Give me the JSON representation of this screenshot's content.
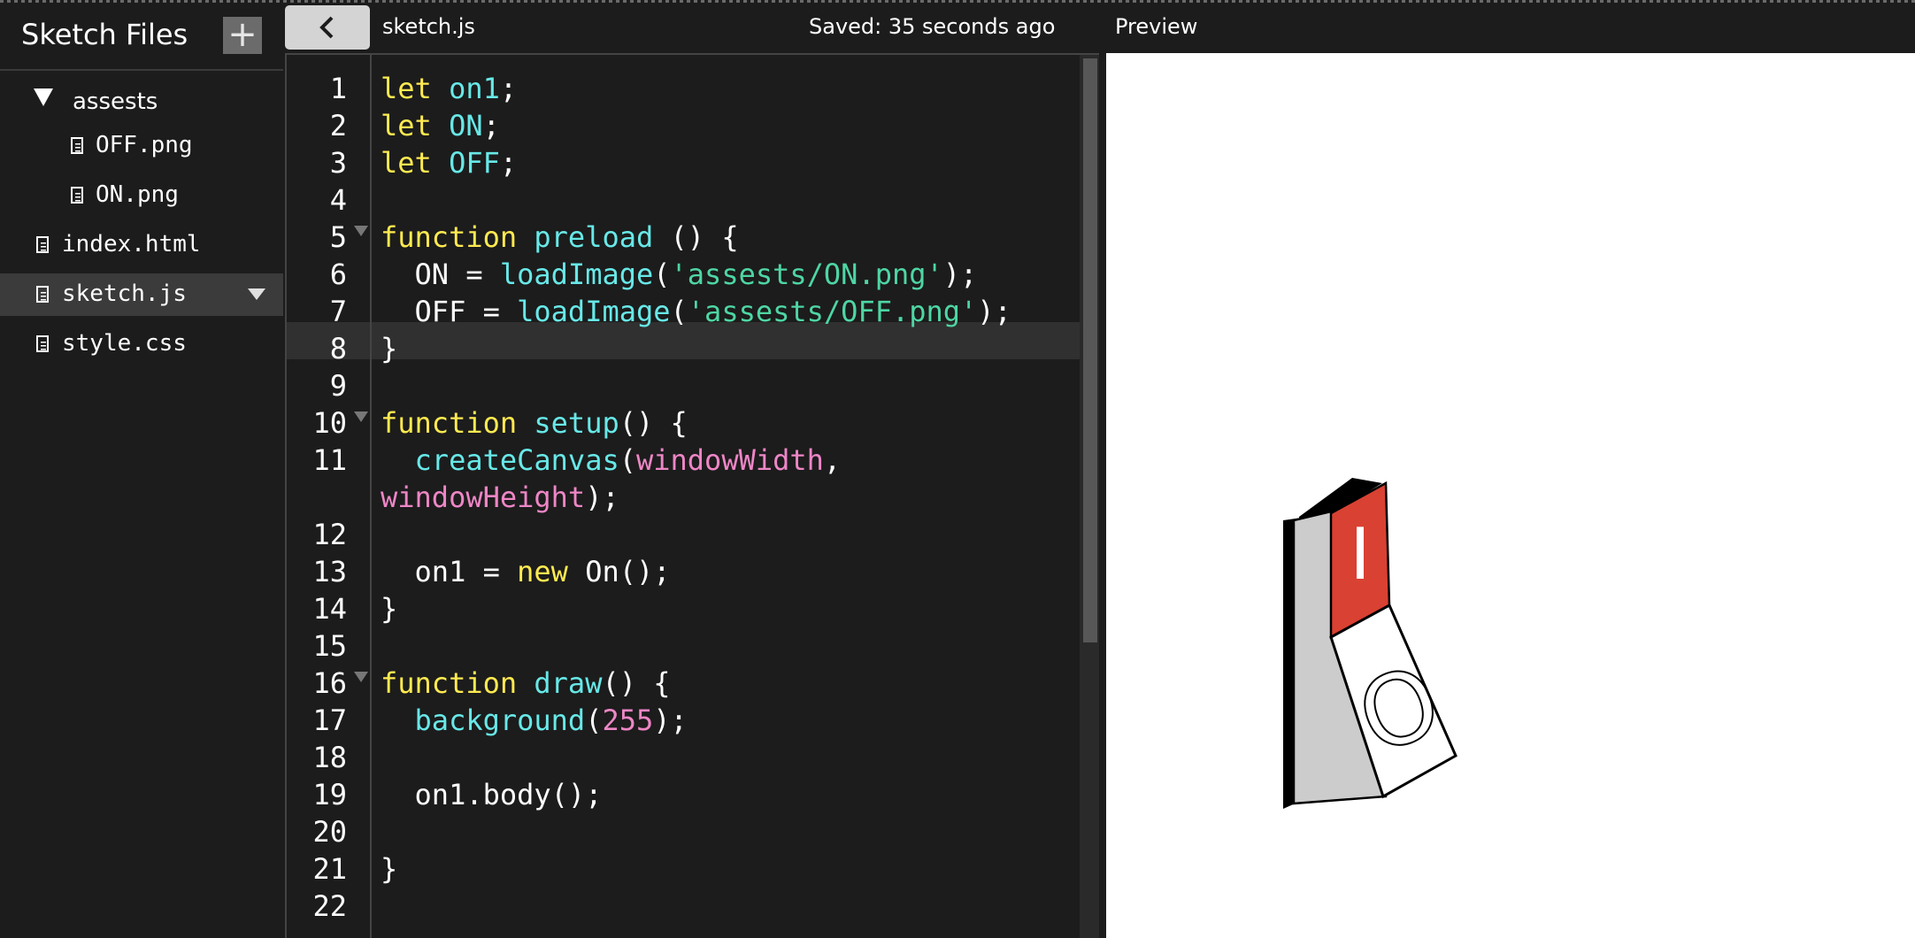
{
  "sidebar": {
    "title": "Sketch Files",
    "add_button": "+",
    "folder": {
      "name": "assests",
      "files": [
        "OFF.png",
        "ON.png"
      ]
    },
    "files": [
      "index.html",
      "sketch.js",
      "style.css"
    ],
    "selected_file": "sketch.js"
  },
  "editor": {
    "filename": "sketch.js",
    "save_status": "Saved: 35 seconds ago",
    "active_line": 7,
    "line_numbers": [
      "1",
      "2",
      "3",
      "4",
      "5",
      "6",
      "7",
      "8",
      "9",
      "10",
      "11",
      "12",
      "13",
      "14",
      "15",
      "16",
      "17",
      "18",
      "19",
      "20",
      "21",
      "22"
    ],
    "fold_lines": [
      5,
      10,
      16
    ],
    "code_lines": [
      [
        [
          "kw",
          "let "
        ],
        [
          "id",
          "on1"
        ],
        [
          "pl",
          ";"
        ]
      ],
      [
        [
          "kw",
          "let "
        ],
        [
          "id",
          "ON"
        ],
        [
          "pl",
          ";"
        ]
      ],
      [
        [
          "kw",
          "let "
        ],
        [
          "id",
          "OFF"
        ],
        [
          "pl",
          ";"
        ]
      ],
      [],
      [
        [
          "kw",
          "function "
        ],
        [
          "fn",
          "preload"
        ],
        [
          "pl",
          " () {"
        ]
      ],
      [
        [
          "pl",
          "  ON = "
        ],
        [
          "fn",
          "loadImage"
        ],
        [
          "pl",
          "("
        ],
        [
          "str",
          "'assests/ON.png'"
        ],
        [
          "pl",
          ");"
        ]
      ],
      [
        [
          "pl",
          "  OFF = "
        ],
        [
          "fn",
          "loadImage"
        ],
        [
          "pl",
          "("
        ],
        [
          "str",
          "'assests/OFF.png'"
        ],
        [
          "pl",
          ");"
        ]
      ],
      [
        [
          "pl",
          "}"
        ]
      ],
      [],
      [
        [
          "kw",
          "function "
        ],
        [
          "fn",
          "setup"
        ],
        [
          "pl",
          "() {"
        ]
      ],
      [
        [
          "pl",
          "  "
        ],
        [
          "fn",
          "createCanvas"
        ],
        [
          "pl",
          "("
        ],
        [
          "glb",
          "windowWidth"
        ],
        [
          "pl",
          ","
        ]
      ],
      [
        [
          "glb",
          "windowHeight"
        ],
        [
          "pl",
          ");"
        ]
      ],
      [],
      [
        [
          "pl",
          "  on1 = "
        ],
        [
          "kw",
          "new "
        ],
        [
          "pl",
          "On();"
        ]
      ],
      [
        [
          "pl",
          "}"
        ]
      ],
      [],
      [
        [
          "kw",
          "function "
        ],
        [
          "fn",
          "draw"
        ],
        [
          "pl",
          "() {"
        ]
      ],
      [
        [
          "pl",
          "  "
        ],
        [
          "fn",
          "background"
        ],
        [
          "pl",
          "("
        ],
        [
          "num",
          "255"
        ],
        [
          "pl",
          ");"
        ]
      ],
      [],
      [
        [
          "pl",
          "  on1.body();"
        ]
      ],
      [],
      [
        [
          "pl",
          "}"
        ]
      ],
      []
    ],
    "line_number_rows": [
      0,
      1,
      2,
      3,
      4,
      5,
      6,
      7,
      8,
      9,
      10,
      12,
      13,
      14,
      15,
      16,
      17,
      18,
      19,
      20,
      21,
      22
    ]
  },
  "preview": {
    "label": "Preview",
    "switch": {
      "on_symbol": "I",
      "off_symbol": "O",
      "on_color": "#d94132",
      "body_color": "#cccccc"
    }
  }
}
